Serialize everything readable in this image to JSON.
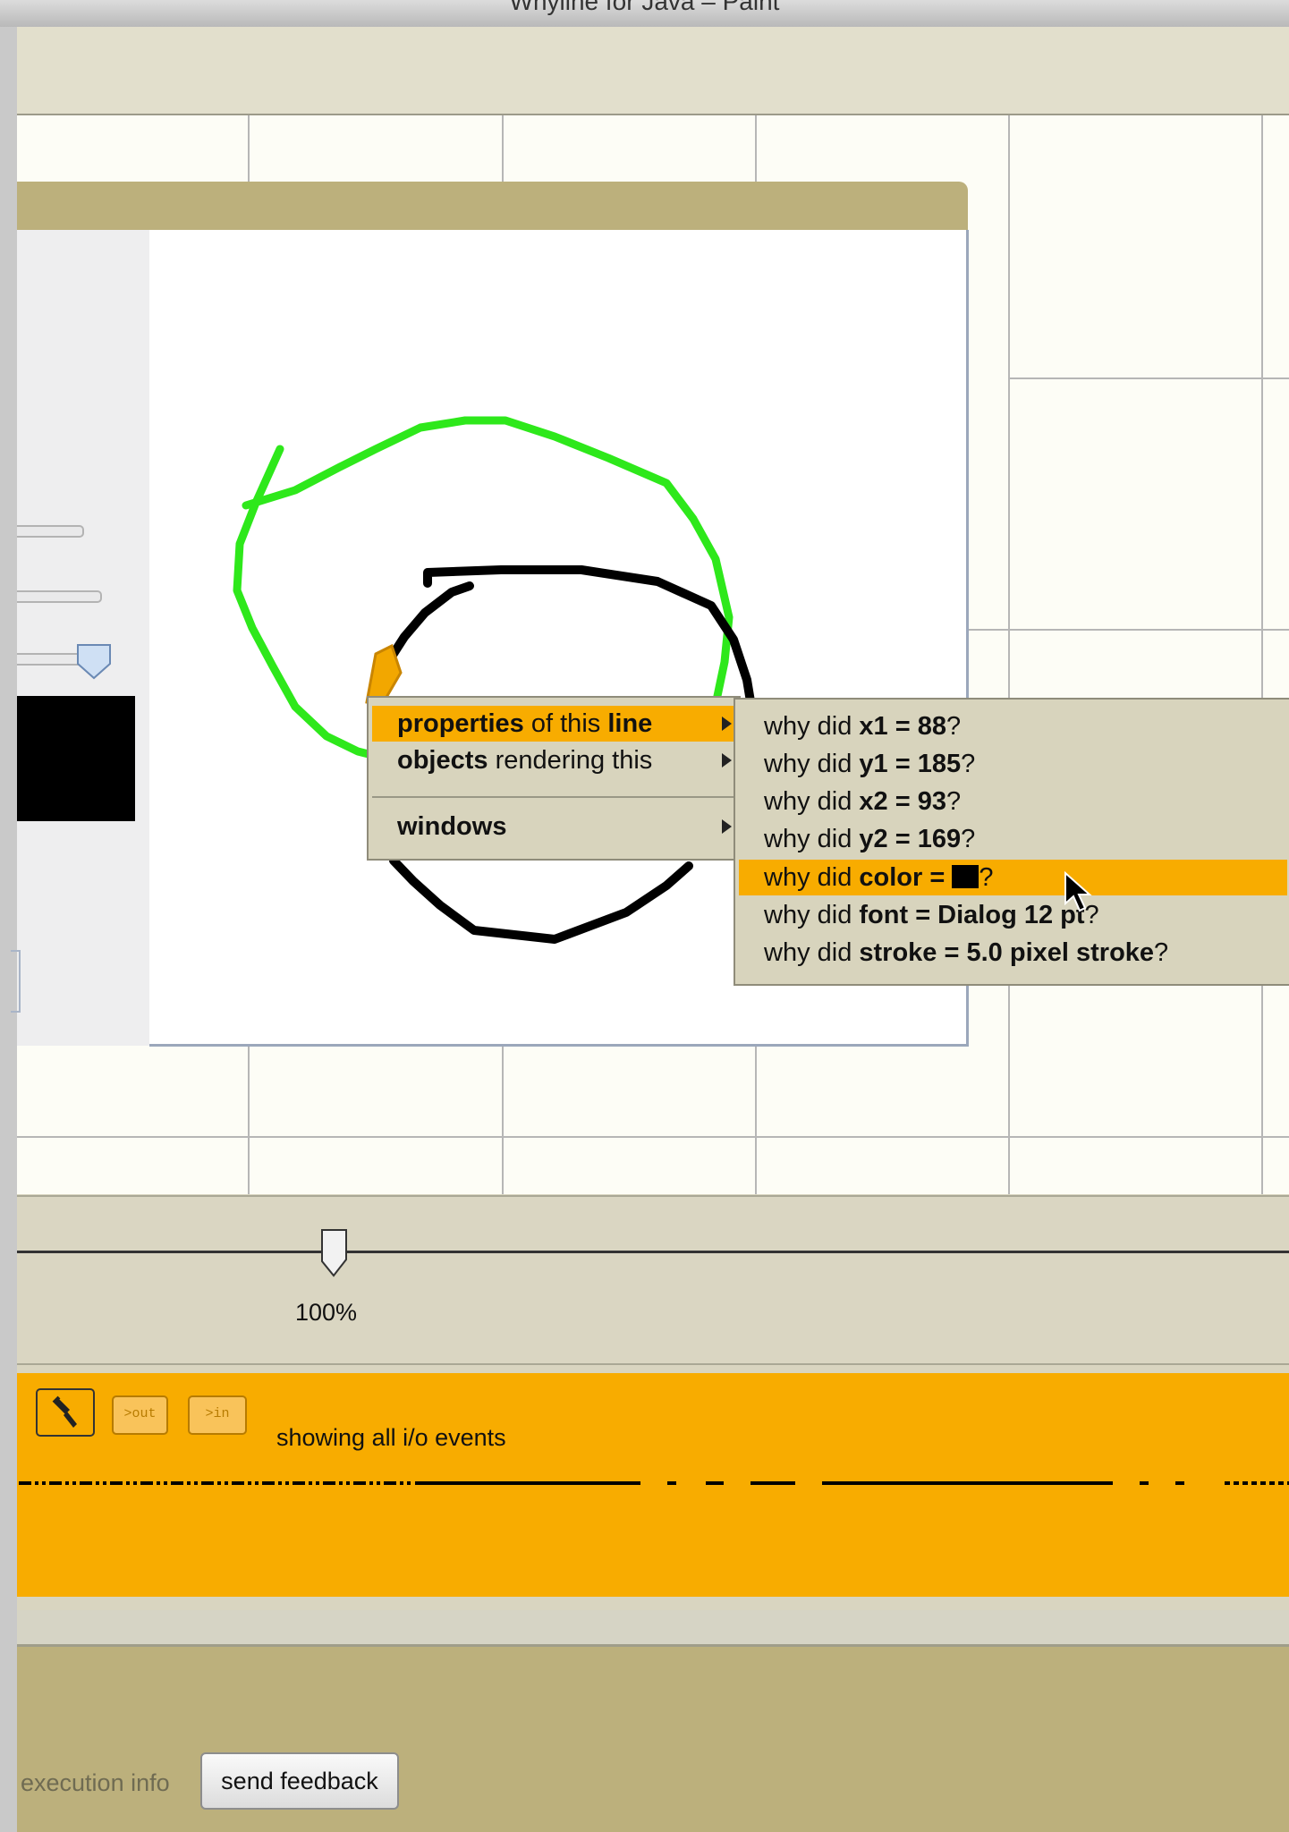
{
  "window": {
    "title": "Whyline for Java – Paint"
  },
  "context_menu": {
    "items": [
      {
        "bold_a": "properties",
        "text_b": " of this ",
        "bold_c": "line",
        "selected": true
      },
      {
        "bold_a": "objects",
        "text_b": " rendering this",
        "bold_c": "",
        "selected": false
      },
      {
        "bold_a": "windows",
        "text_b": "",
        "bold_c": "",
        "selected": false
      }
    ]
  },
  "why_menu": {
    "items": [
      {
        "prefix": "why did ",
        "prop": "x1 = 88",
        "suffix": "?"
      },
      {
        "prefix": "why did ",
        "prop": "y1 = 185",
        "suffix": "?"
      },
      {
        "prefix": "why did ",
        "prop": "x2 = 93",
        "suffix": "?"
      },
      {
        "prefix": "why did ",
        "prop": "y2 = 169",
        "suffix": "?"
      },
      {
        "prefix": "why did ",
        "prop": "color = ",
        "suffix": "?",
        "swatch_color": "#000000",
        "selected": true
      },
      {
        "prefix": "why did ",
        "prop": "font = Dialog 12 pt",
        "suffix": "?"
      },
      {
        "prefix": "why did ",
        "prop": "stroke = 5.0 pixel stroke",
        "suffix": "?"
      }
    ]
  },
  "zoom": {
    "label": "100%"
  },
  "timeline": {
    "buttons": [
      {
        "name": "hammer-icon",
        "label": ""
      },
      {
        "name": "out-events-icon",
        "label": ">out"
      },
      {
        "name": "in-events-icon",
        "label": ">in"
      }
    ],
    "status": "showing all i/o events"
  },
  "footer": {
    "execution_info_label": "execution info",
    "send_feedback_label": "send feedback"
  },
  "colors": {
    "accent": "#f8ac00",
    "menu_bg": "#d8d4bd",
    "window_title": "#bcb07c",
    "green_stroke": "#2ee81b"
  }
}
